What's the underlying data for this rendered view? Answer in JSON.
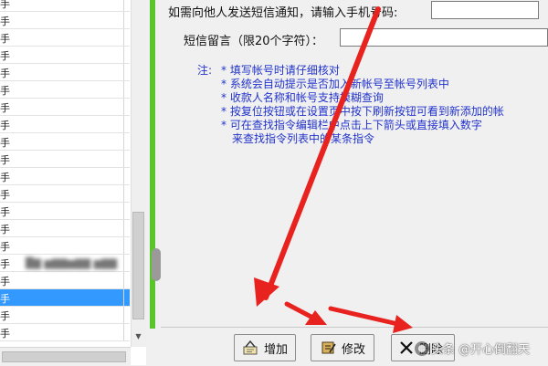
{
  "phone_prompt": "如需向他人发送短信通知，请输入手机号码:",
  "sms_label": "短信留言（限20个字符）：",
  "notes_label": "注:",
  "notes": [
    "* 填写帐号时请仔细核对",
    "* 系统会自动提示是否加入新帐号至帐号列表中",
    "* 收款人名称和帐号支持模糊查询",
    "* 按复位按钮或在设置页中按下刷新按钮可看到新添加的帐",
    "* 可在查找指令编辑栏中点击上下箭头或直接填入数字",
    "来查找指令列表中的某条指令"
  ],
  "list": {
    "prefix_char": "手",
    "row_count": 20,
    "selected_index": 17,
    "blurred_index": 15,
    "blurred_text": "█▇ ▆▇▇▆▇▇ ▆▇▇"
  },
  "buttons": {
    "add": "增加",
    "edit": "修改",
    "delete": "删除"
  },
  "watermark": "头条 @开心倒翻天",
  "colors": {
    "arrow": "#e8231f",
    "note_text": "#2233cc",
    "splitter": "#58c62a",
    "selection": "#3399ff"
  }
}
